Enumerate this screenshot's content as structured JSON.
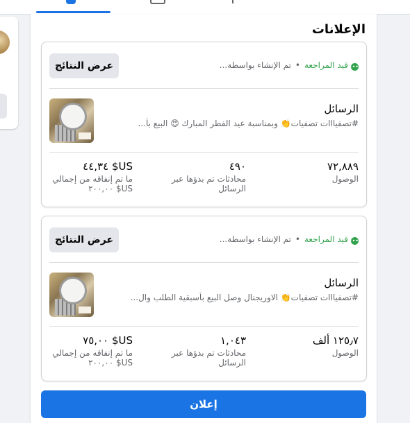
{
  "section_title": "الإعلانات",
  "ads": [
    {
      "status": "قيد المراجعة",
      "created_by": "تم الإنشاء بواسطة...",
      "results_button": "عرض النتائج",
      "name": "الرسائل",
      "description": "#تصفيااات تصفيات👏 وبمناسبة عيد الفطر المبارك 😍 البيع بأ...",
      "reach_value": "٧٢,٨٨٩",
      "reach_label": "الوصول",
      "convos_value": "٤٩٠",
      "convos_label": "محادثات تم بدؤها عبر الرسائل",
      "spent_value": "US$ ٤٤,٣٤",
      "spent_label": "ما تم إنفاقه من إجمالي US$ ٢٠٠,٠٠"
    },
    {
      "status": "قيد المراجعة",
      "created_by": "تم الإنشاء بواسطة...",
      "results_button": "عرض النتائج",
      "name": "الرسائل",
      "description": "#تصفيااات تصفيات👏 الاوريجنال وصل البيع بأسبقية الطلب وال...",
      "reach_value": "١٢٥٫٧ ألف",
      "reach_label": "الوصول",
      "convos_value": "١,٠٤٣",
      "convos_label": "محادثات تم بدؤها عبر الرسائل",
      "spent_value": "US$ ٧٥,٠٠",
      "spent_label": "ما تم إنفاقه من إجمالي US$ ٢٠٠,٠٠"
    }
  ],
  "promote_button": "إعلان",
  "colors": {
    "accent": "#1b74e4",
    "status_green": "#31a24c",
    "secondary_text": "#65676b"
  }
}
